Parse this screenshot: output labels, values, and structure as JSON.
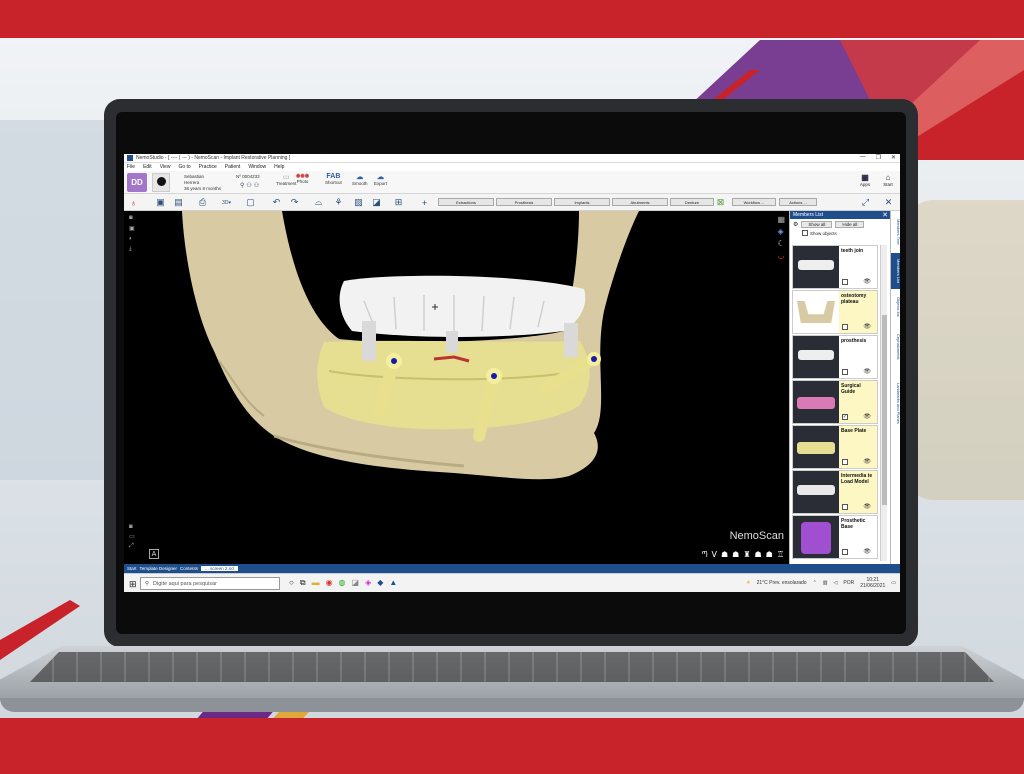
{
  "window": {
    "app_title": "NemoStudio - [ ---- ( --- ) - NemoScan - Implant Restorative Planning ]",
    "controls": [
      "—",
      "❐",
      "✕"
    ]
  },
  "menu": [
    "File",
    "Edit",
    "View",
    "Go to",
    "Practice",
    "Patient",
    "Window",
    "Help"
  ],
  "patient": {
    "initials": "DD",
    "name_line1": "Sebastian",
    "name_line2": "Herrera",
    "age": "38 years 8 months",
    "id": "Nº 0004233"
  },
  "ribbon": {
    "groups": [
      {
        "icon": "▭",
        "label": "Treatment"
      },
      {
        "icon": "◉◉◉",
        "label": "Photo"
      },
      {
        "icon": "FAB",
        "label": "Shortcut"
      },
      {
        "icon": "☁",
        "label": "Smooth"
      },
      {
        "icon": "☁",
        "label": "Export"
      }
    ],
    "apps_label": "Apps",
    "start_label": "Start"
  },
  "steps": [
    "Extractions",
    "Prosthesis",
    "Implants",
    "Abutments",
    "Denture",
    "Workflow ...",
    "Actions ..."
  ],
  "viewport": {
    "brand": "NemoScan",
    "a_button": "A",
    "view_icons": [
      "ᘉ",
      "ᐯ",
      "☗",
      "☗",
      "♜",
      "☗",
      "☗",
      "♖"
    ]
  },
  "panel": {
    "title": "Members List",
    "show_all": "Show all",
    "hide_all": "Hide all",
    "show_objects": "Show objects",
    "items": [
      {
        "label": "teeth join",
        "checked": false,
        "selected": false
      },
      {
        "label": "osteotomy plateau",
        "checked": false,
        "selected": true
      },
      {
        "label": "prosthesis",
        "checked": false,
        "selected": false
      },
      {
        "label": "Surgical Guide",
        "checked": true,
        "selected": true
      },
      {
        "label": "Base Plate",
        "checked": false,
        "selected": true
      },
      {
        "label": "Intermedia te Load Model",
        "checked": false,
        "selected": true
      },
      {
        "label": "Prosthetic Base",
        "checked": false,
        "selected": false
      }
    ]
  },
  "side_tabs": [
    "Members Tree",
    "Members List",
    "Objects list",
    "Cephalometric",
    "Landmarks and Planes"
  ],
  "doc_tabs": [
    "Start",
    "Template Designer",
    "Contents",
    "... screen 2.ncl"
  ],
  "taskbar": {
    "search_placeholder": "Digite aqui para pesquisar",
    "weather": "21°C Prev. ensolarado",
    "lang": "POR",
    "time": "10:21",
    "date": "21/06/2021"
  },
  "colors": {
    "brand_red": "#c8232b",
    "accent_blue": "#1e4f8c",
    "badge_purple": "#a276c9",
    "bone": "#d8cba3",
    "guide_yellow": "#e6df91"
  }
}
